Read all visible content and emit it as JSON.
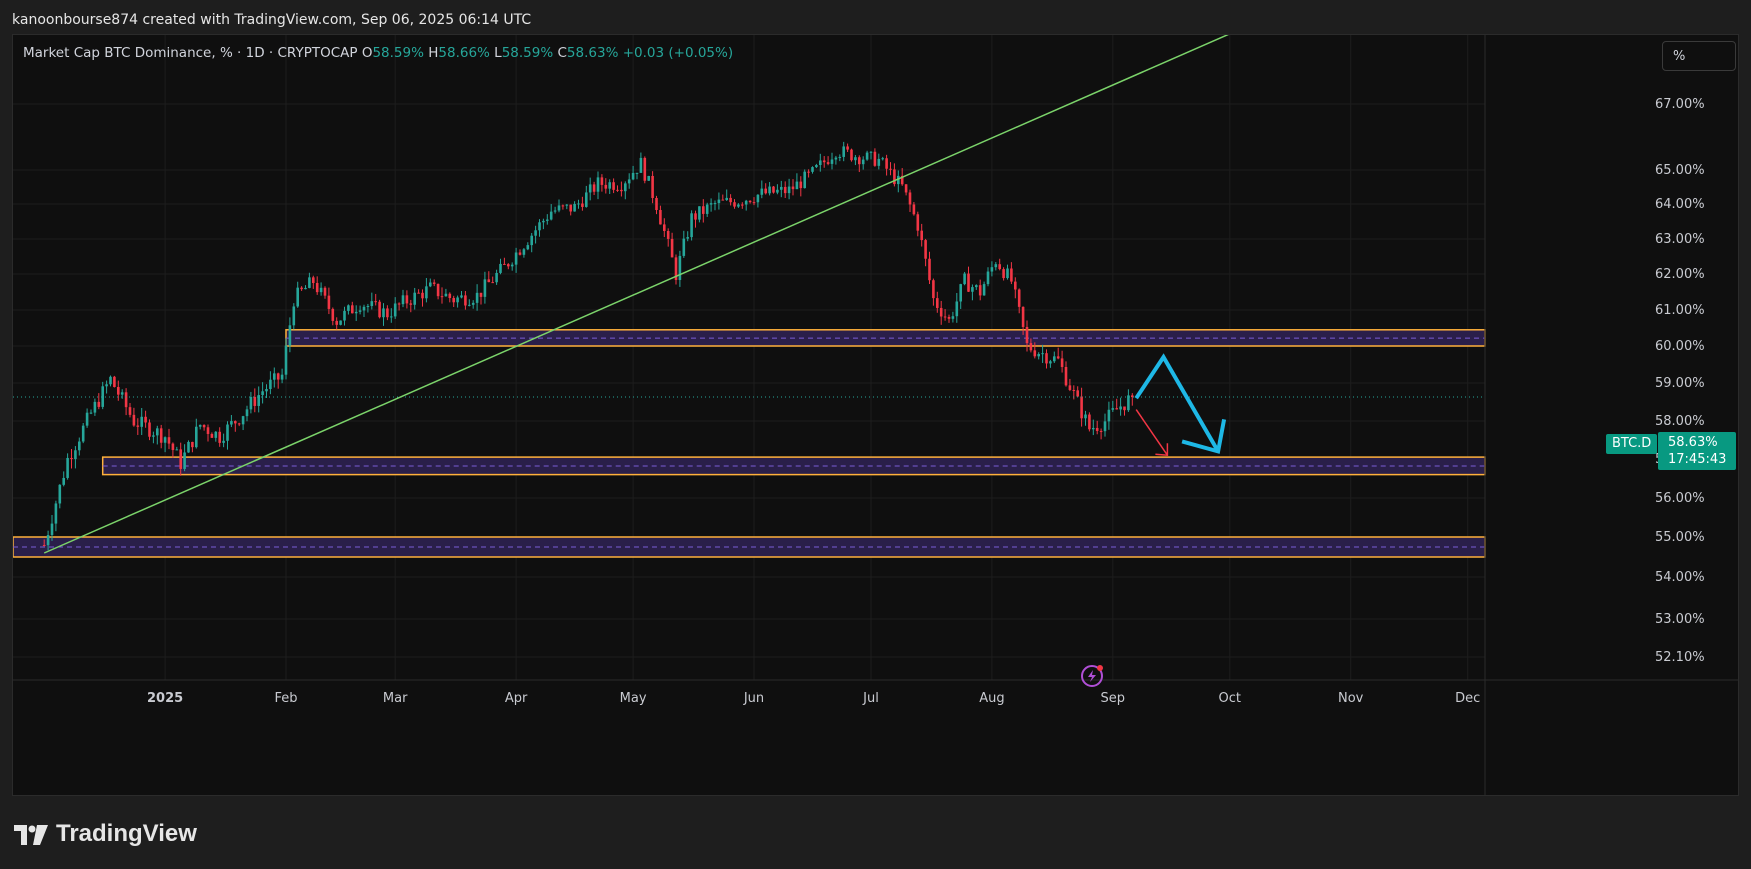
{
  "header": {
    "attribution": "kanoonbourse874 created with TradingView.com, Sep 06, 2025 06:14 UTC"
  },
  "legend": {
    "title": "Market Cap BTC Dominance, % · 1D · CRYPTOCAP",
    "o_label": "O",
    "o_value": "58.59%",
    "h_label": "H",
    "h_value": "58.66%",
    "l_label": "L",
    "l_value": "58.59%",
    "c_label": "C",
    "c_value": "58.63%",
    "change": "+0.03 (+0.05%)"
  },
  "scale_button": {
    "label": "%"
  },
  "price_tag": {
    "symbol": "BTC.D",
    "price": "58.63%",
    "countdown": "17:45:43"
  },
  "brand": {
    "name": "TradingView"
  },
  "colors": {
    "up": "#26a69a",
    "down": "#f23645",
    "zone_border": "#ffb13b",
    "zone_fill": "#2a1f4a",
    "trendline": "#7bd36a",
    "arrow_big": "#1eb8e6",
    "arrow_small": "#f23645"
  },
  "chart_data": {
    "type": "candlestick",
    "title": "Market Cap BTC Dominance, % · 1D · CRYPTOCAP",
    "y_ticks": [
      "67.00%",
      "65.00%",
      "64.00%",
      "63.00%",
      "62.00%",
      "61.00%",
      "60.00%",
      "59.00%",
      "58.00%",
      "57.00%",
      "56.00%",
      "55.00%",
      "54.00%",
      "53.00%",
      "52.10%"
    ],
    "x_ticks": [
      "2025",
      "Feb",
      "Mar",
      "Apr",
      "May",
      "Jun",
      "Jul",
      "Aug",
      "Sep",
      "Oct",
      "Nov",
      "Dec"
    ],
    "ylim": [
      51.7,
      67.8
    ],
    "close_path": [
      [
        "2024-12-01",
        54.8
      ],
      [
        "2024-12-07",
        57.0
      ],
      [
        "2024-12-13",
        58.2
      ],
      [
        "2024-12-18",
        59.1
      ],
      [
        "2024-12-24",
        58.0
      ],
      [
        "2025-01-01",
        57.6
      ],
      [
        "2025-01-05",
        56.9
      ],
      [
        "2025-01-10",
        57.9
      ],
      [
        "2025-01-15",
        57.6
      ],
      [
        "2025-01-20",
        58.1
      ],
      [
        "2025-01-26",
        58.8
      ],
      [
        "2025-01-31",
        59.2
      ],
      [
        "2025-02-03",
        61.3
      ],
      [
        "2025-02-08",
        61.8
      ],
      [
        "2025-02-14",
        60.7
      ],
      [
        "2025-02-20",
        61.2
      ],
      [
        "2025-02-27",
        60.9
      ],
      [
        "2025-03-03",
        61.2
      ],
      [
        "2025-03-10",
        61.6
      ],
      [
        "2025-03-16",
        61.3
      ],
      [
        "2025-03-22",
        61.4
      ],
      [
        "2025-03-29",
        62.2
      ],
      [
        "2025-04-04",
        63.0
      ],
      [
        "2025-04-10",
        63.8
      ],
      [
        "2025-04-16",
        63.9
      ],
      [
        "2025-04-22",
        64.6
      ],
      [
        "2025-04-28",
        64.6
      ],
      [
        "2025-05-03",
        65.2
      ],
      [
        "2025-05-07",
        64.0
      ],
      [
        "2025-05-12",
        62.0
      ],
      [
        "2025-05-16",
        63.6
      ],
      [
        "2025-05-22",
        64.0
      ],
      [
        "2025-05-28",
        64.1
      ],
      [
        "2025-06-03",
        64.3
      ],
      [
        "2025-06-10",
        64.4
      ],
      [
        "2025-06-16",
        64.9
      ],
      [
        "2025-06-22",
        65.6
      ],
      [
        "2025-06-28",
        65.4
      ],
      [
        "2025-07-03",
        65.3
      ],
      [
        "2025-07-09",
        64.5
      ],
      [
        "2025-07-13",
        63.4
      ],
      [
        "2025-07-17",
        61.3
      ],
      [
        "2025-07-21",
        60.7
      ],
      [
        "2025-07-25",
        61.8
      ],
      [
        "2025-07-29",
        61.5
      ],
      [
        "2025-08-02",
        62.4
      ],
      [
        "2025-08-06",
        61.8
      ],
      [
        "2025-08-10",
        60.0
      ],
      [
        "2025-08-14",
        59.8
      ],
      [
        "2025-08-18",
        59.6
      ],
      [
        "2025-08-22",
        58.7
      ],
      [
        "2025-08-26",
        57.8
      ],
      [
        "2025-08-30",
        58.0
      ],
      [
        "2025-09-03",
        58.4
      ],
      [
        "2025-09-06",
        58.63
      ]
    ],
    "current_value": 58.63,
    "zones": [
      {
        "from": 60.0,
        "to": 60.45,
        "mid": 60.22
      },
      {
        "from": 56.6,
        "to": 57.05,
        "mid": 56.82
      },
      {
        "from": 54.5,
        "to": 55.0,
        "mid": 54.75
      }
    ],
    "trendline": [
      [
        "2024-12-01",
        54.6
      ],
      [
        "2025-10-14",
        69.8
      ]
    ],
    "projection_big": [
      [
        "2025-09-07",
        58.6
      ],
      [
        "2025-09-14",
        59.7
      ],
      [
        "2025-09-28",
        57.2
      ]
    ],
    "projection_small": [
      [
        "2025-09-07",
        58.3
      ],
      [
        "2025-09-15",
        57.1
      ]
    ]
  }
}
